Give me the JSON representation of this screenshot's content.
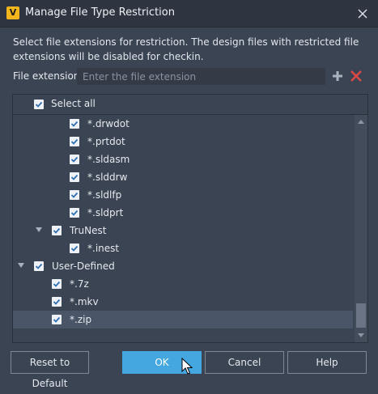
{
  "window": {
    "app_icon_text": "V",
    "title": "Manage File Type Restriction",
    "close_icon": "close-icon"
  },
  "description": "Select file extensions for restriction. The design files with restricted file extensions will be disabled for checkin.",
  "extension_field": {
    "label": "File extension:",
    "value": "",
    "placeholder": "Enter the file extension",
    "add_icon": "plus-icon",
    "remove_icon": "x-icon"
  },
  "tree": {
    "select_all_label": "Select all",
    "select_all_checked": true,
    "rows": [
      {
        "label": "*.drwdot",
        "level": 2,
        "checked": true,
        "expander": false,
        "selected": false
      },
      {
        "label": "*.prtdot",
        "level": 2,
        "checked": true,
        "expander": false,
        "selected": false
      },
      {
        "label": "*.sldasm",
        "level": 2,
        "checked": true,
        "expander": false,
        "selected": false
      },
      {
        "label": "*.slddrw",
        "level": 2,
        "checked": true,
        "expander": false,
        "selected": false
      },
      {
        "label": "*.sldlfp",
        "level": 2,
        "checked": true,
        "expander": false,
        "selected": false
      },
      {
        "label": "*.sldprt",
        "level": 2,
        "checked": true,
        "expander": false,
        "selected": false
      },
      {
        "label": "TruNest",
        "level": 1,
        "checked": true,
        "expander": true,
        "selected": false
      },
      {
        "label": "*.inest",
        "level": 2,
        "checked": true,
        "expander": false,
        "selected": false
      },
      {
        "label": "User-Defined",
        "level": 0,
        "checked": true,
        "expander": true,
        "selected": false
      },
      {
        "label": "*.7z",
        "level": 1,
        "checked": true,
        "expander": false,
        "selected": false
      },
      {
        "label": "*.mkv",
        "level": 1,
        "checked": true,
        "expander": false,
        "selected": false
      },
      {
        "label": "*.zip",
        "level": 1,
        "checked": true,
        "expander": false,
        "selected": true
      }
    ]
  },
  "buttons": {
    "reset": "Reset to Default",
    "ok": "OK",
    "cancel": "Cancel",
    "help": "Help"
  },
  "colors": {
    "background": "#3b4453",
    "primary_button": "#44a7e0",
    "remove_icon": "#e04848",
    "selected_row": "#4a5668"
  }
}
